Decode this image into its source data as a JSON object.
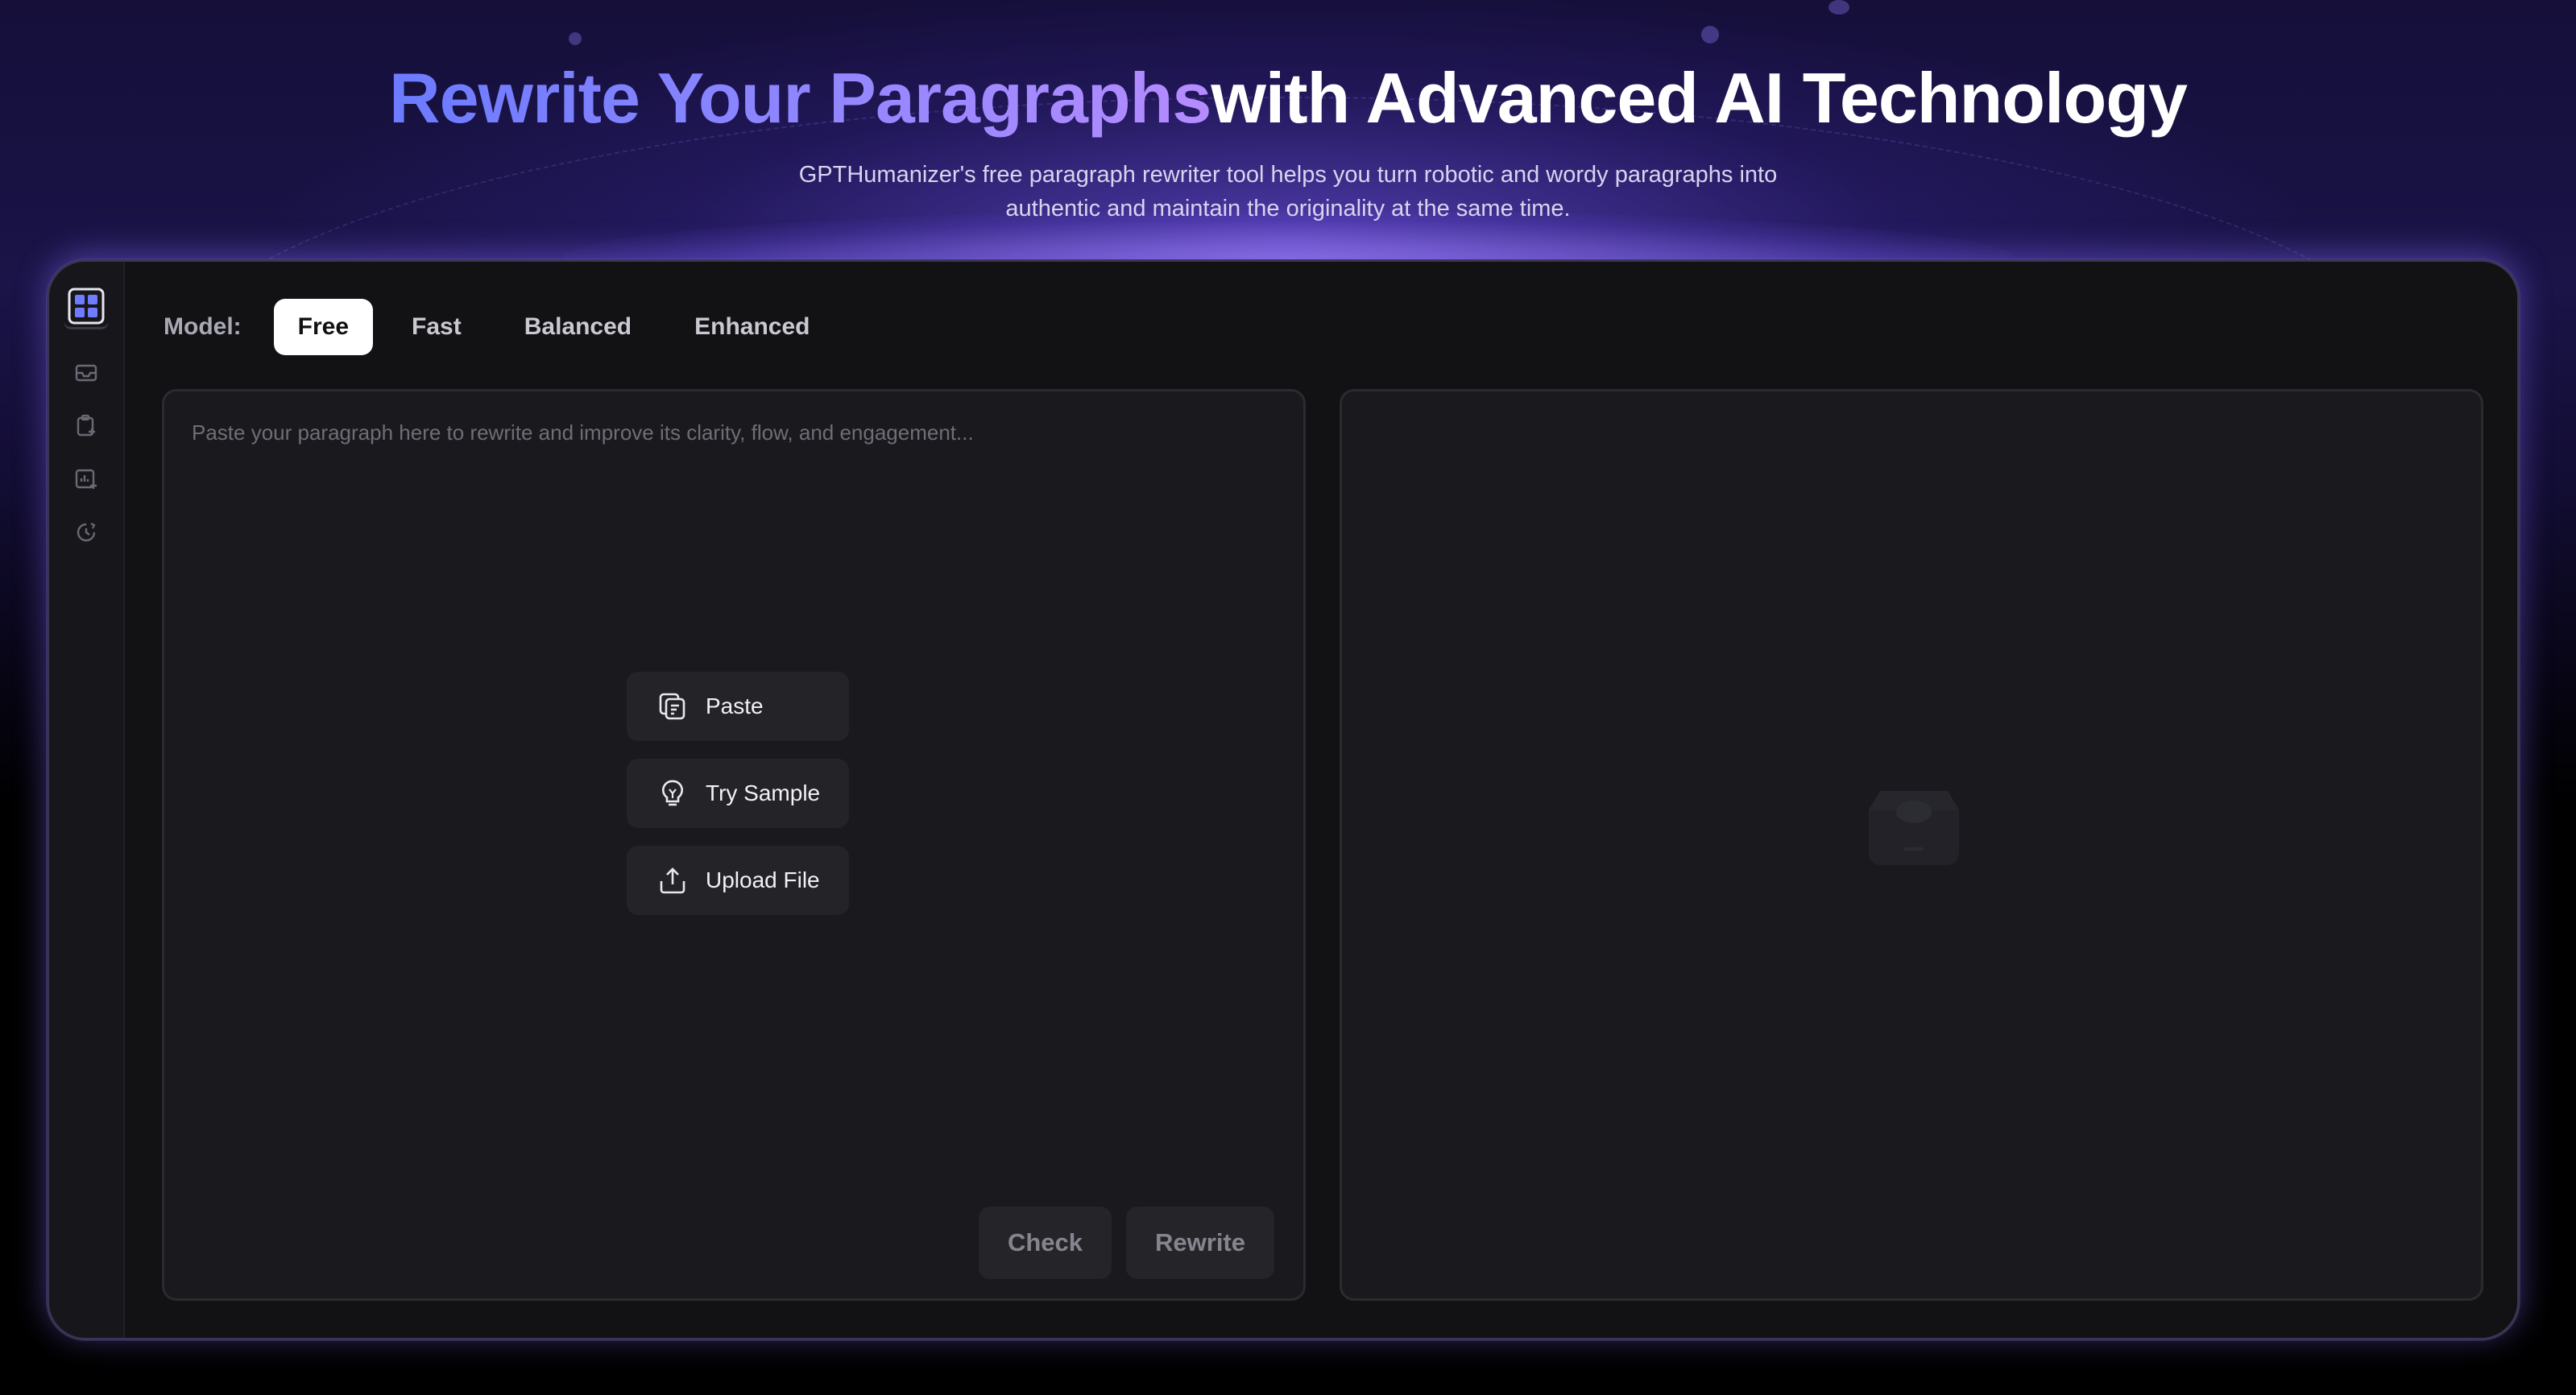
{
  "hero": {
    "title_accent": "Rewrite Your Paragraphs",
    "title_rest": "with Advanced AI Technology",
    "subtitle": "GPTHumanizer's free paragraph rewriter tool helps you turn robotic and wordy paragraphs into authentic and maintain the originality at the same time."
  },
  "sidebar": {
    "items": [
      {
        "icon": "grid-apps-icon",
        "active": true
      },
      {
        "icon": "inbox-icon",
        "active": false
      },
      {
        "icon": "clipboard-add-icon",
        "active": false
      },
      {
        "icon": "chart-add-icon",
        "active": false
      },
      {
        "icon": "history-clock-icon",
        "active": false
      }
    ]
  },
  "model": {
    "label": "Model:",
    "tabs": [
      {
        "label": "Free",
        "active": true
      },
      {
        "label": "Fast",
        "active": false
      },
      {
        "label": "Balanced",
        "active": false
      },
      {
        "label": "Enhanced",
        "active": false
      }
    ]
  },
  "editor": {
    "value": "",
    "placeholder": "Paste your paragraph here to rewrite and improve its clarity, flow, and engagement...",
    "actions": {
      "paste": "Paste",
      "try_sample": "Try Sample",
      "upload_file": "Upload File"
    },
    "check_label": "Check",
    "rewrite_label": "Rewrite"
  },
  "colors": {
    "accent": "#7b7dff",
    "panel": "#1a1a1e",
    "active_tab": "#ffffff"
  }
}
